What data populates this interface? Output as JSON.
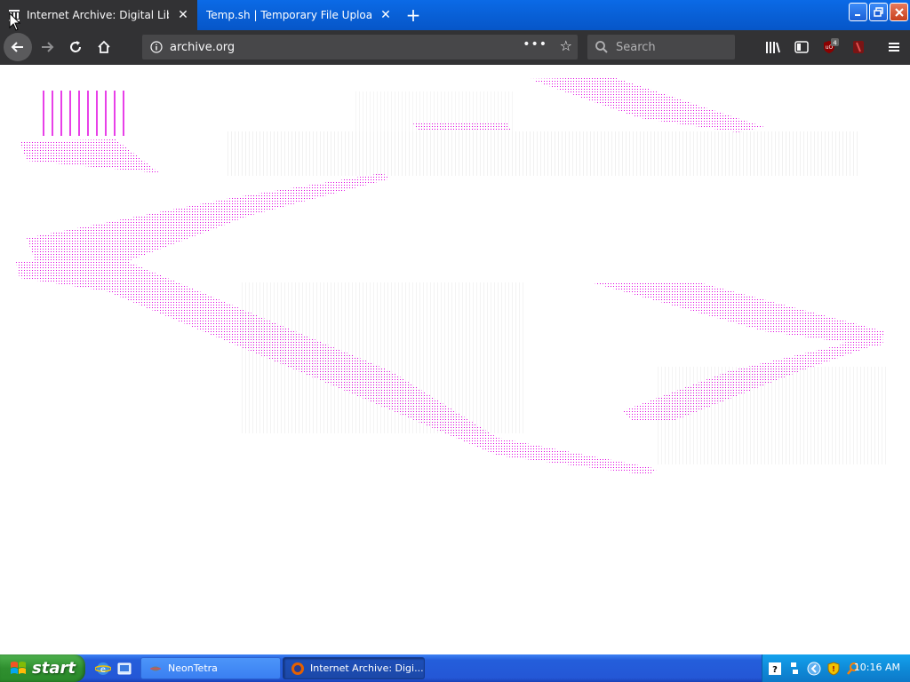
{
  "browser": {
    "tabs": [
      {
        "title": "Internet Archive: Digital Library of",
        "active": true
      },
      {
        "title": "Temp.sh | Temporary File Upload",
        "active": false
      }
    ],
    "new_tab_label": "+",
    "url": "archive.org",
    "search_placeholder": "Search",
    "more_label": "•••",
    "addon_badge": "4"
  },
  "taskbar": {
    "start_label": "start",
    "items": [
      {
        "label": "NeonTetra"
      },
      {
        "label": "Internet Archive: Digi..."
      }
    ],
    "clock": "10:16 AM"
  },
  "colors": {
    "accent_magenta": "#e000e0",
    "browser_chrome": "#323234",
    "xp_blue": "#245edb",
    "start_green": "#2f8f2f"
  }
}
